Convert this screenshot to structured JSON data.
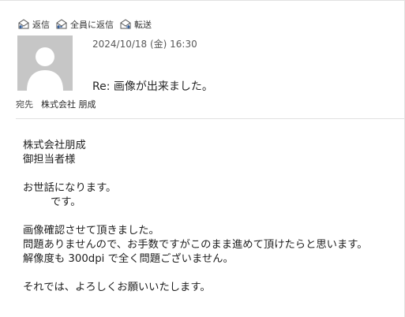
{
  "toolbar": {
    "reply_label": "返信",
    "reply_all_label": "全員に返信",
    "forward_label": "転送"
  },
  "message": {
    "date": "2024/10/18 (金) 16:30",
    "subject": "Re: 画像が出来ました。",
    "recipient_label": "宛先",
    "recipient": "株式会社 朋成"
  },
  "body": {
    "line1": "株式会社朋成",
    "line2": "御担当者様",
    "line3": "お世話になります。",
    "line4": "です。",
    "line5": "画像確認させて頂きました。",
    "line6": "問題ありませんので、お手数ですがこのまま進めて頂けたらと思います。",
    "line7": "解像度も 300dpi で全く問題ございません。",
    "line8": "それでは、よろしくお願いいたします。"
  },
  "colors": {
    "icon_blue": "#2b5797",
    "avatar_bg": "#c6c6c6"
  }
}
